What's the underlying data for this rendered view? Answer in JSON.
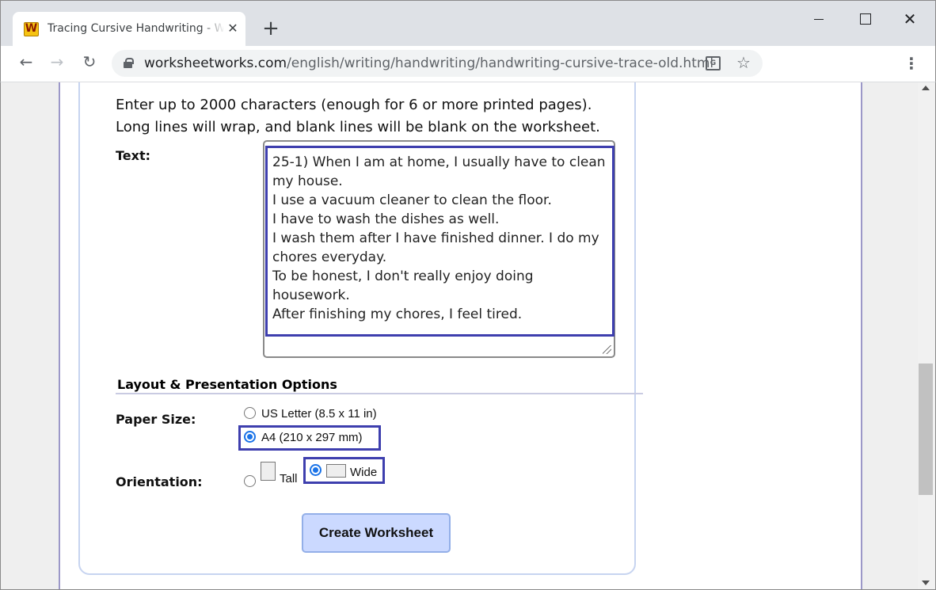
{
  "browser": {
    "tab_title": "Tracing Cursive Handwriting - W",
    "tab_favicon_letter": "W",
    "new_tab_symbol": "+",
    "close_symbol": "✕",
    "url_host": "worksheetworks.com",
    "url_path": "/english/writing/handwriting/handwriting-cursive-trace-old.html",
    "nav_back": "←",
    "nav_forward": "→",
    "nav_reload": "↻",
    "star": "☆",
    "menu": "⋮",
    "translate_glyph": "G",
    "window_close": "✕"
  },
  "form": {
    "intro_line1": "Enter up to 2000 characters (enough for 6 or more printed pages).",
    "intro_line2": "Long lines will wrap, and blank lines will be blank on the worksheet.",
    "text_label": "Text:",
    "text_value": "25-1) When I am at home, I usually have to clean my house.\nI use a vacuum cleaner to clean the floor.\nI have to wash the dishes as well.\nI wash them after I have finished dinner. I do my chores everyday.\nTo be honest, I don't really enjoy doing housework.\nAfter finishing my chores, I feel tired.",
    "section_heading": "Layout & Presentation Options",
    "paper_size_label": "Paper Size:",
    "paper_options": [
      {
        "label": "US Letter (8.5 x 11 in)",
        "selected": false
      },
      {
        "label": "A4 (210 x 297 mm)",
        "selected": true
      }
    ],
    "orientation_label": "Orientation:",
    "orientation_options": [
      {
        "label": "Tall",
        "selected": false
      },
      {
        "label": "Wide",
        "selected": true
      }
    ],
    "create_button": "Create Worksheet"
  },
  "colors": {
    "highlight": "#3e3fae",
    "radio_selected": "#1a73e8",
    "button_bg": "#cbd9ff",
    "card_border": "#c7d4f0"
  },
  "icons": [
    "favicon-w-icon",
    "close-icon",
    "plus-icon",
    "back-arrow-icon",
    "forward-arrow-icon",
    "reload-icon",
    "lock-icon",
    "translate-icon",
    "star-icon",
    "kebab-menu-icon"
  ]
}
